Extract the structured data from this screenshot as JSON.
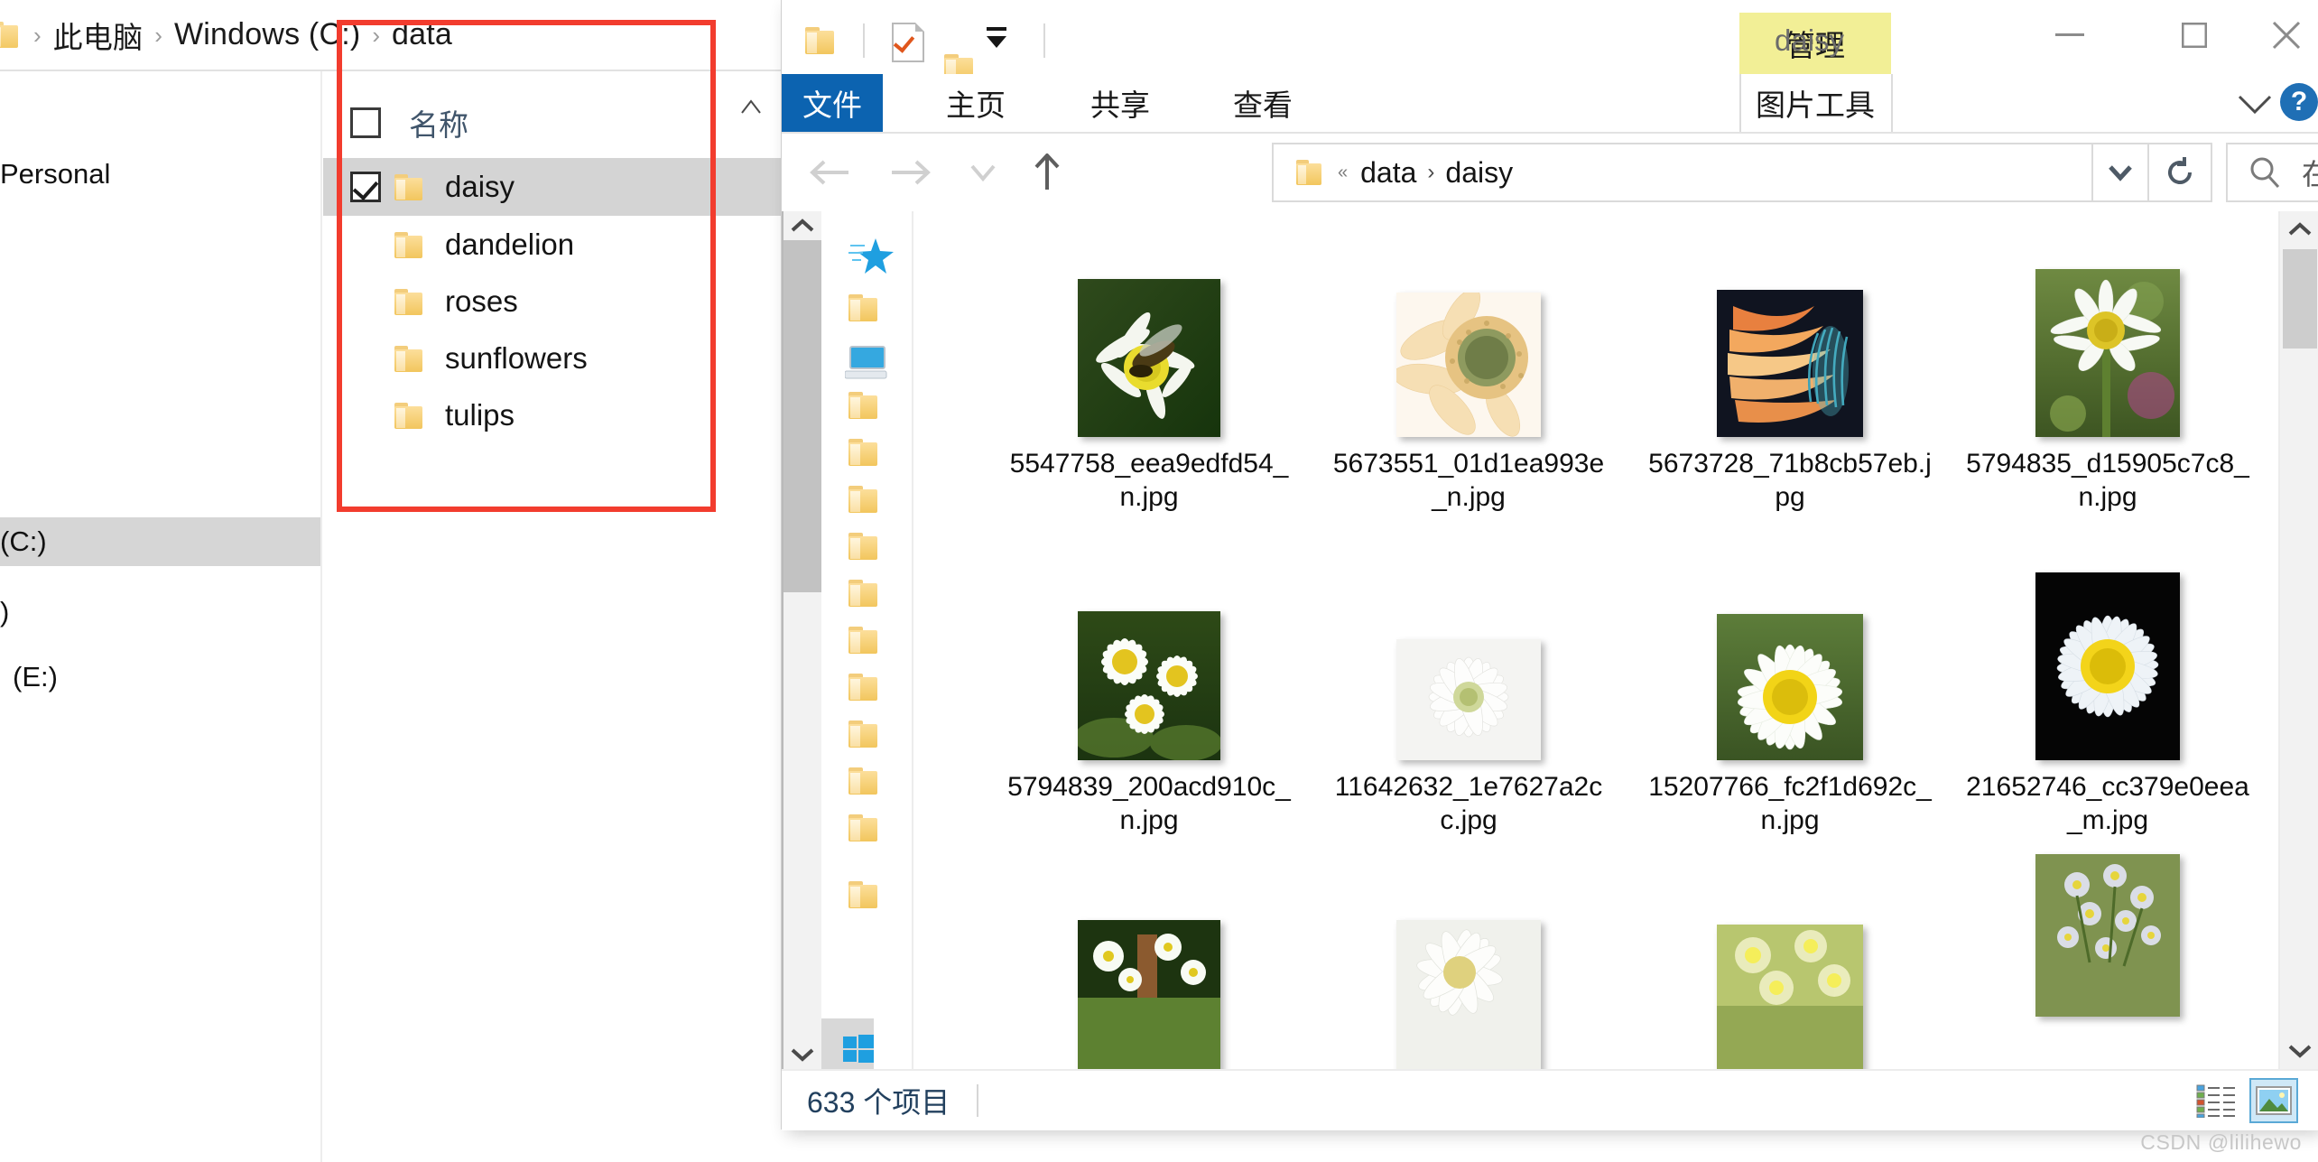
{
  "background_window": {
    "breadcrumb": {
      "icon": "folder-icon",
      "items": [
        "此电脑",
        "Windows (C:)",
        "data"
      ],
      "separator": "›"
    },
    "sidebar_items": [
      {
        "label": "Personal",
        "selected": false
      },
      {
        "label": "(C:)",
        "selected": true
      },
      {
        "label": ")",
        "selected": false
      },
      {
        "label": "(E:)",
        "selected": false
      }
    ],
    "column_header": "名称",
    "rows": [
      {
        "name": "daisy",
        "checked": true,
        "selected": true
      },
      {
        "name": "dandelion",
        "checked": false,
        "selected": false
      },
      {
        "name": "roses",
        "checked": false,
        "selected": false
      },
      {
        "name": "sunflowers",
        "checked": false,
        "selected": false
      },
      {
        "name": "tulips",
        "checked": false,
        "selected": false
      }
    ],
    "annotation_color": "#f23c2e"
  },
  "main_window": {
    "title": "daisy",
    "quick_access": {
      "folder_icon": "folder-icon",
      "properties_icon": "properties-checkmark-icon",
      "new_folder_icon": "new-folder-icon",
      "customize_icon": "customize-dropdown-icon"
    },
    "window_controls": {
      "minimize": "minimize-icon",
      "maximize": "maximize-icon",
      "close": "close-icon"
    },
    "contextual_tab": "管理",
    "ribbon_tabs": [
      {
        "label": "文件",
        "active": true
      },
      {
        "label": "主页",
        "active": false
      },
      {
        "label": "共享",
        "active": false
      },
      {
        "label": "查看",
        "active": false
      },
      {
        "label": "图片工具",
        "active": false
      }
    ],
    "ribbon_collapse_icon": "chevron-down-icon",
    "help_icon": "?",
    "address_bar": {
      "back_icon": "arrow-left-icon",
      "forward_icon": "arrow-right-icon",
      "recent_icon": "chevron-down-icon",
      "up_icon": "arrow-up-icon",
      "folder_icon": "folder-icon",
      "overflow": "«",
      "crumbs": [
        "data",
        "daisy"
      ],
      "crumb_separator": "›",
      "dropdown_icon": "chevron-down-icon",
      "refresh_icon": "refresh-icon"
    },
    "search": {
      "icon": "search-icon",
      "placeholder": "在 daisy 中搜索"
    },
    "nav_pane": {
      "icons": [
        "quick-access-star-icon",
        "folder-icon",
        "this-pc-icon",
        "folder-icon",
        "folder-icon",
        "folder-icon",
        "folder-icon",
        "folder-icon",
        "folder-icon",
        "folder-icon"
      ],
      "scroll_up_icon": "chevron-up-icon",
      "scroll_down_icon": "chevron-down-icon",
      "windows_logo_icon": "windows-logo-icon"
    },
    "files": [
      {
        "name": "5547758_eea9edfd54_n.jpg",
        "thumb": "daisy-with-hoverfly"
      },
      {
        "name": "5673551_01d1ea993e_n.jpg",
        "thumb": "cream-gerbera-closeup"
      },
      {
        "name": "5673728_71b8cb57eb.jpg",
        "thumb": "orange-teal-petals"
      },
      {
        "name": "5794835_d15905c7c8_n.jpg",
        "thumb": "white-daisy-green-bokeh"
      },
      {
        "name": "5794839_200acd910c_n.jpg",
        "thumb": "three-white-daisies"
      },
      {
        "name": "11642632_1e7627a2cc.jpg",
        "thumb": "white-daisy-high-key"
      },
      {
        "name": "15207766_fc2f1d692c_n.jpg",
        "thumb": "macro-white-daisy"
      },
      {
        "name": "21652746_cc379e0eea_m.jpg",
        "thumb": "daisy-on-black"
      },
      {
        "name": "",
        "thumb": "daisies-in-field"
      },
      {
        "name": "",
        "thumb": "white-daisy-side"
      },
      {
        "name": "",
        "thumb": "yellow-white-blooms"
      },
      {
        "name": "",
        "thumb": "pale-aster-cluster"
      }
    ],
    "status_bar": {
      "count_text": "633 个项目",
      "view_details_icon": "details-view-icon",
      "view_large_icons_icon": "large-icons-view-icon",
      "active_view": "large-icons-view-icon"
    }
  },
  "watermark": "CSDN @lilihewo"
}
